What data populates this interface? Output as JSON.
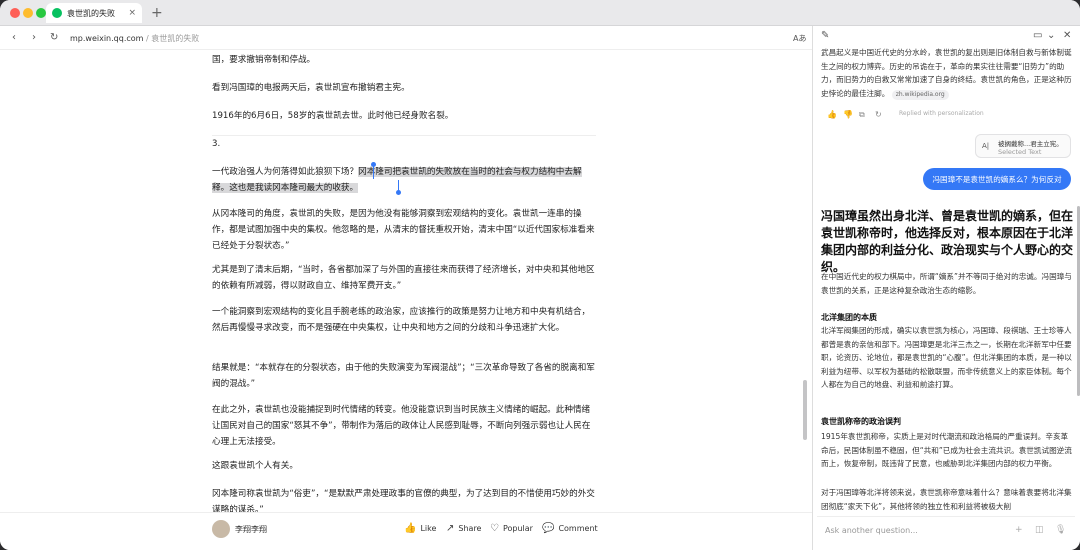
{
  "tab": {
    "title": "袁世凯的失败",
    "close": "×",
    "new_tab": "+"
  },
  "address": {
    "domain": "mp.weixin.qq.com",
    "separator": "/",
    "page_title": "袁世凯的失败",
    "reader": "Aあ"
  },
  "article": {
    "p1": "国，要求撤销帝制和停战。",
    "p2": "看到冯国璋的电报两天后，袁世凯宣布撤销君主宪。",
    "p3": "1916年的6月6日，58岁的袁世凯去世。此时他已经身败名裂。",
    "section": "3.",
    "p4_pre": "一代政治强人为何落得如此狼狈下场？",
    "p4_hl": "冈本隆司把袁世凯的失败放在当时的社会与权力结构中去解释。这也是我读冈本隆司最大的收获。",
    "p5": "从冈本隆司的角度，袁世凯的失败，是因为他没有能够洞察到宏观结构的变化。袁世凯一连串的操作，都是试图加强中央的集权。他忽略的是，从清末的督抚重权开始，清末中国“以近代国家标准看来已经处于分裂状态。”",
    "p6": "尤其是到了清末后期，“当时，各省都加深了与外国的直接往来而获得了经济增长，对中央和其他地区的依赖有所减弱，得以财政自立、维持军费开支。”",
    "p7": "一个能洞察到宏观结构的变化且手腕老练的政治家，应该推行的政策是努力让地方和中央有机结合，然后再慢慢寻求改变，而不是强硬在中央集权，让中央和地方之间的分歧和斗争迅速扩大化。",
    "p8": "结果就是：“本就存在的分裂状态，由于他的失败演变为军阀混战”；“三次革命导致了各省的脱离和军阀的混战。”",
    "p9": "在此之外，袁世凯也没能捕捉到时代情绪的转变。他没能意识到当时民族主义情绪的崛起。此种情绪让国民对自己的国家“怒其不争”，带制作为落后的政体让人民感到耻辱，不断向列强示弱也让人民在心理上无法接受。",
    "p10": "这跟袁世凯个人有关。",
    "p11": "冈本隆司称袁世凯为“俗吏”，“是默默严肃处理政事的官僚的典型，为了达到目的不惜使用巧妙的外交谋略的谋杀。”"
  },
  "bottom": {
    "author": "李翔李翔",
    "like": "Like",
    "share": "Share",
    "popular": "Popular",
    "comment": "Comment"
  },
  "sidebar": {
    "intro1": "武昌起义是中国近代史的分水岭，袁世凯的复出则是旧体制自救与新体制诞生之间的权力博弈。历史的吊诡在于，革命的果实往往需要“旧势力”的助力，而旧势力的自救又常常加速了自身的终结。袁世凯的角色，正是这种历史悖论的最佳注脚。",
    "cite": "zh.wikipedia.org",
    "replied": "Replied with personalization",
    "sel_title": "被搁戴称...君主立宪。",
    "sel_sub": "Selected Text",
    "question": "冯国璋不是袁世凯的嫡系么？为何反对",
    "answer_title": "冯国璋虽然出身北洋、曾是袁世凯的嫡系，但在袁世凯称帝时，他选择反对，根本原因在于北洋集团内部的利益分化、政治现实与个人野心的交织。",
    "answer_p1": "在中国近代史的权力棋局中，所谓“嫡系”并不等同于绝对的忠诚。冯国璋与袁世凯的关系，正是这种复杂政治生态的缩影。",
    "h1": "北洋集团的本质",
    "answer_p2": "北洋军阀集团的形成，确实以袁世凯为核心，冯国璋、段祺瑞、王士珍等人都曾是袁的亲信和部下。冯国璋更是北洋三杰之一，长期在北洋新军中任要职，论资历、论地位，都是袁世凯的“心腹”。但北洋集团的本质，是一种以利益为纽带、以军权为基础的松散联盟，而非传统意义上的家臣体制。每个人都在为自己的地盘、利益和前途打算。",
    "h2": "袁世凯称帝的政治误判",
    "answer_p3": "1915年袁世凯称帝，实质上是对时代潮流和政治格局的严重误判。辛亥革命后，民国体制虽不稳固，但“共和”已成为社会主流共识。袁世凯试图逆流而上，恢复帝制，既违背了民意，也威胁到北洋集团内部的权力平衡。",
    "answer_p4": "对于冯国璋等北洋将领来说，袁世凯称帝意味着什么？意味着袁要将北洋集团彻底“家天下化”，其他将领的独立性和利益将被极大削",
    "ask_placeholder": "Ask another question...",
    "ask_plus": "+"
  }
}
